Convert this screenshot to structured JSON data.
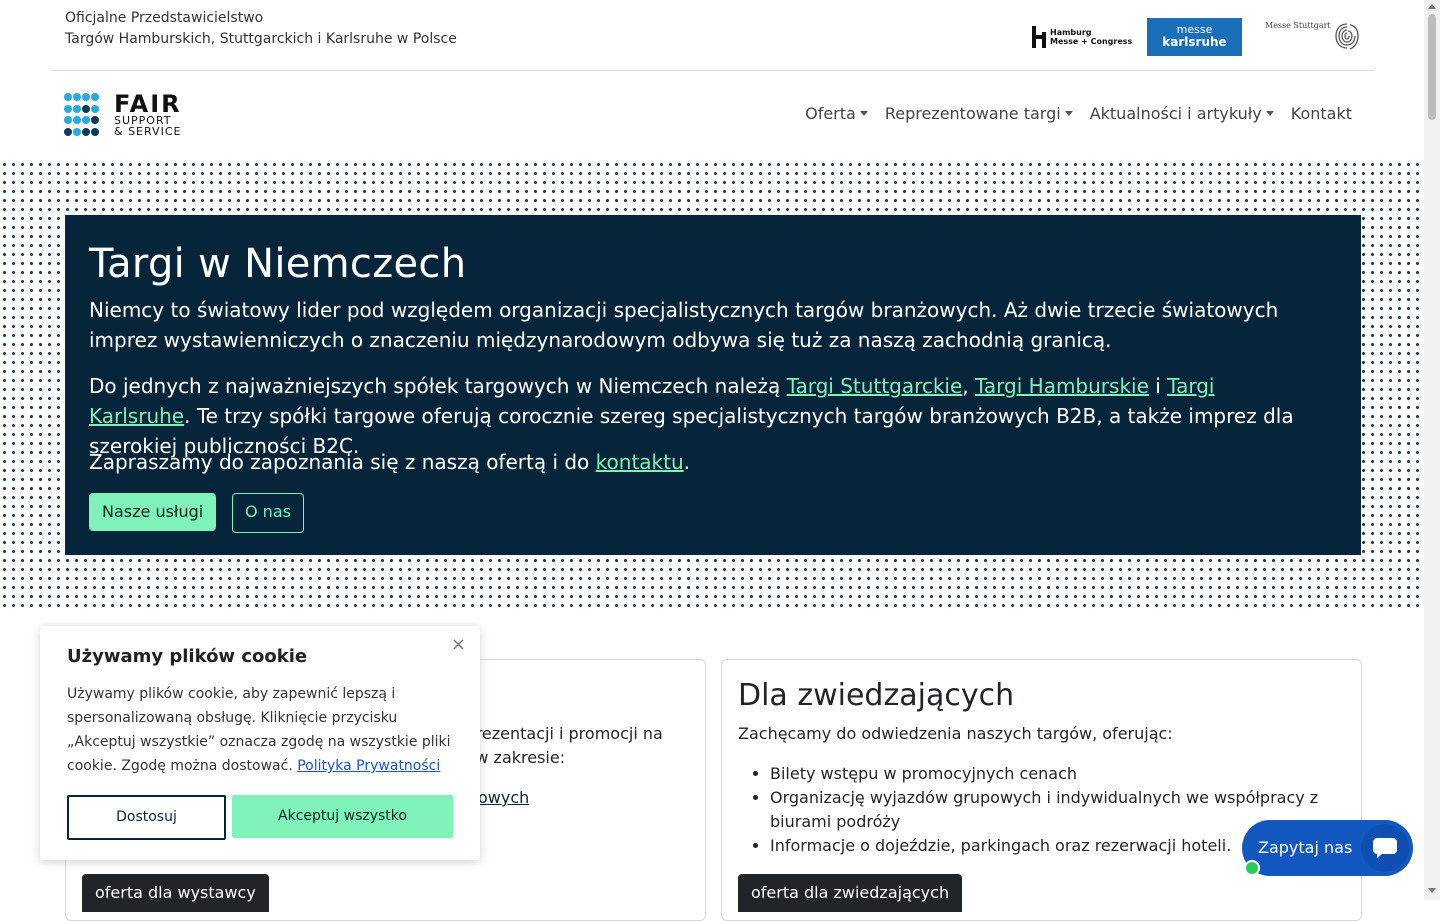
{
  "topbar": {
    "official_line1": "Oficjalne Przedstawicielstwo",
    "official_line2": "Targów Hamburskich, Stuttgarckich i Karlsruhe w Polsce",
    "hamburg_logo_line1": "Hamburg",
    "hamburg_logo_line2": "Messe + Congress",
    "karlsruhe_logo_line1": "messe",
    "karlsruhe_logo_line2": "karlsruhe",
    "stuttgart_logo": "Messe Stuttgart"
  },
  "brand": {
    "name": "FAIR",
    "sub1": "SUPPORT",
    "sub2": "& SERVICE"
  },
  "nav": {
    "items": [
      {
        "label": "Oferta",
        "dropdown": true
      },
      {
        "label": "Reprezentowane targi",
        "dropdown": true
      },
      {
        "label": "Aktualności i artykuły",
        "dropdown": true
      },
      {
        "label": "Kontakt",
        "dropdown": false
      }
    ]
  },
  "hero": {
    "title": "Targi w Niemczech",
    "p1": "Niemcy to światowy lider pod względem organizacji specjalistycznych targów branżowych. Aż dwie trzecie światowych imprez wystawienniczych o znaczeniu międzynarodowym odbywa się tuż za naszą zachodnią granicą.",
    "p2_before": "Do jednych z najważniejszych spółek targowych w Niemczech należą ",
    "link_stuttgart": "Targi Stuttgarckie",
    "sep1": ", ",
    "link_hamburg": "Targi Hamburskie",
    "sep2": " i ",
    "link_karlsruhe": "Targi Karlsruhe",
    "p2_after": ". Te trzy spółki targowe oferują corocznie szereg specjalistycznych targów branżowych B2B, a także imprez dla szerokiej publiczności B2C.",
    "p3_before": "Zapraszamy do zapoznania się z naszą ofertą i do ",
    "link_contact": "kontaktu",
    "p3_after": ".",
    "btn_services": "Nasze usługi",
    "btn_about": "O nas"
  },
  "card_exhibitors": {
    "lead_fragment1": "i prezentacji i promocji na",
    "lead_fragment2": "ie w zakresie:",
    "link_fragment": "owych",
    "button": "oferta dla wystawcy"
  },
  "card_visitors": {
    "title": "Dla zwiedzających",
    "lead": "Zachęcamy do odwiedzenia naszych targów, oferując:",
    "items": [
      "Bilety wstępu w promocyjnych cenach",
      "Organizację wyjazdów grupowych i indywidualnych we współpracy z biurami podróży",
      "Informacje o dojeździe, parkingach oraz rezerwacji hoteli."
    ],
    "button": "oferta dla zwiedzających"
  },
  "cookie": {
    "title": "Używamy plików cookie",
    "message": "Używamy plików cookie, aby zapewnić lepszą i spersonalizowaną obsługę. Kliknięcie przycisku „Akceptuj wszystkie” oznacza zgodę na wszystkie pliki cookie. Zgodę można dostować. ",
    "policy_link": "Polityka Prywatności",
    "btn_customize": "Dostosuj",
    "btn_accept": "Akceptuj wszystko",
    "close_icon": "×"
  },
  "chat": {
    "label": "Zapytaj nas"
  },
  "colors": {
    "hero_bg": "#06253a",
    "accent_mint": "#7ef2b9",
    "chat_blue": "#1358c0",
    "brand_light_dot": "#29a9e1",
    "brand_dark_dot": "#0a3b5c"
  }
}
